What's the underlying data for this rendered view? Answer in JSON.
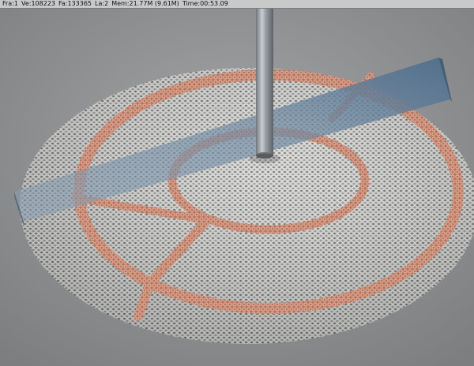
{
  "status_bar": {
    "frame": "Fra:1",
    "vertices": "Ve:108223",
    "faces": "Fa:133365",
    "lamps": "La:2",
    "memory": "Mem:21.77M (9.61M)",
    "time": "Time:00:53.09"
  },
  "scene": {
    "objects": [
      "chain-mail-disc",
      "copper-rings",
      "metal-pole",
      "glass-plane"
    ],
    "colors": {
      "background": "#8f9092",
      "mesh": "#c8c8c6",
      "copper": "#c98a70",
      "pole": "#9aa1a6",
      "plane": "#5f7e9a"
    }
  }
}
